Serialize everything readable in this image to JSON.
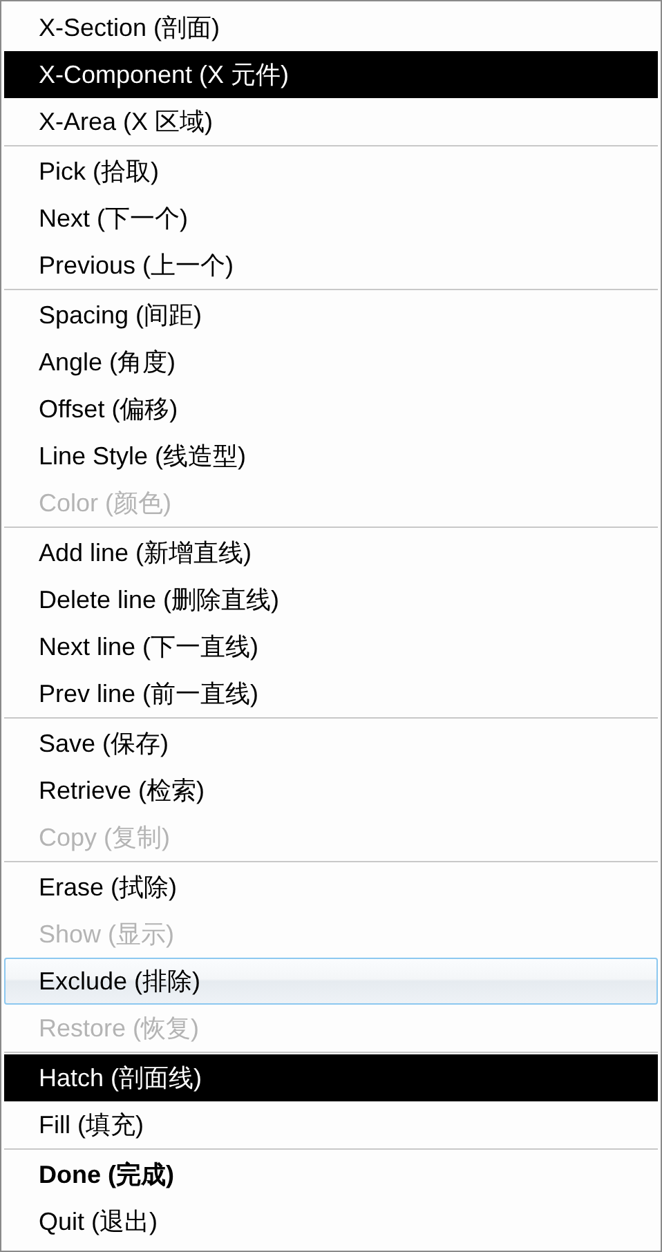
{
  "menu": {
    "groups": [
      {
        "items": [
          {
            "label": "X-Section (剖面)",
            "selected": false,
            "disabled": false,
            "hovered": false,
            "default": false
          },
          {
            "label": "X-Component (X 元件)",
            "selected": true,
            "disabled": false,
            "hovered": false,
            "default": false
          },
          {
            "label": "X-Area (X 区域)",
            "selected": false,
            "disabled": false,
            "hovered": false,
            "default": false
          }
        ]
      },
      {
        "items": [
          {
            "label": "Pick (拾取)",
            "selected": false,
            "disabled": false,
            "hovered": false,
            "default": false
          },
          {
            "label": "Next (下一个)",
            "selected": false,
            "disabled": false,
            "hovered": false,
            "default": false
          },
          {
            "label": "Previous (上一个)",
            "selected": false,
            "disabled": false,
            "hovered": false,
            "default": false
          }
        ]
      },
      {
        "items": [
          {
            "label": "Spacing (间距)",
            "selected": false,
            "disabled": false,
            "hovered": false,
            "default": false
          },
          {
            "label": "Angle (角度)",
            "selected": false,
            "disabled": false,
            "hovered": false,
            "default": false
          },
          {
            "label": "Offset (偏移)",
            "selected": false,
            "disabled": false,
            "hovered": false,
            "default": false
          },
          {
            "label": "Line Style (线造型)",
            "selected": false,
            "disabled": false,
            "hovered": false,
            "default": false
          },
          {
            "label": "Color (颜色)",
            "selected": false,
            "disabled": true,
            "hovered": false,
            "default": false
          }
        ]
      },
      {
        "items": [
          {
            "label": "Add line (新增直线)",
            "selected": false,
            "disabled": false,
            "hovered": false,
            "default": false
          },
          {
            "label": "Delete line (删除直线)",
            "selected": false,
            "disabled": false,
            "hovered": false,
            "default": false
          },
          {
            "label": "Next line (下一直线)",
            "selected": false,
            "disabled": false,
            "hovered": false,
            "default": false
          },
          {
            "label": "Prev line (前一直线)",
            "selected": false,
            "disabled": false,
            "hovered": false,
            "default": false
          }
        ]
      },
      {
        "items": [
          {
            "label": "Save (保存)",
            "selected": false,
            "disabled": false,
            "hovered": false,
            "default": false
          },
          {
            "label": "Retrieve (检索)",
            "selected": false,
            "disabled": false,
            "hovered": false,
            "default": false
          },
          {
            "label": "Copy (复制)",
            "selected": false,
            "disabled": true,
            "hovered": false,
            "default": false
          }
        ]
      },
      {
        "items": [
          {
            "label": "Erase (拭除)",
            "selected": false,
            "disabled": false,
            "hovered": false,
            "default": false
          },
          {
            "label": "Show (显示)",
            "selected": false,
            "disabled": true,
            "hovered": false,
            "default": false
          },
          {
            "label": "Exclude (排除)",
            "selected": false,
            "disabled": false,
            "hovered": true,
            "default": false
          },
          {
            "label": "Restore (恢复)",
            "selected": false,
            "disabled": true,
            "hovered": false,
            "default": false
          }
        ]
      },
      {
        "items": [
          {
            "label": "Hatch (剖面线)",
            "selected": true,
            "disabled": false,
            "hovered": false,
            "default": false
          },
          {
            "label": "Fill (填充)",
            "selected": false,
            "disabled": false,
            "hovered": false,
            "default": false
          }
        ]
      },
      {
        "items": [
          {
            "label": "Done (完成)",
            "selected": false,
            "disabled": false,
            "hovered": false,
            "default": true
          },
          {
            "label": "Quit (退出)",
            "selected": false,
            "disabled": false,
            "hovered": false,
            "default": false
          }
        ]
      }
    ]
  }
}
